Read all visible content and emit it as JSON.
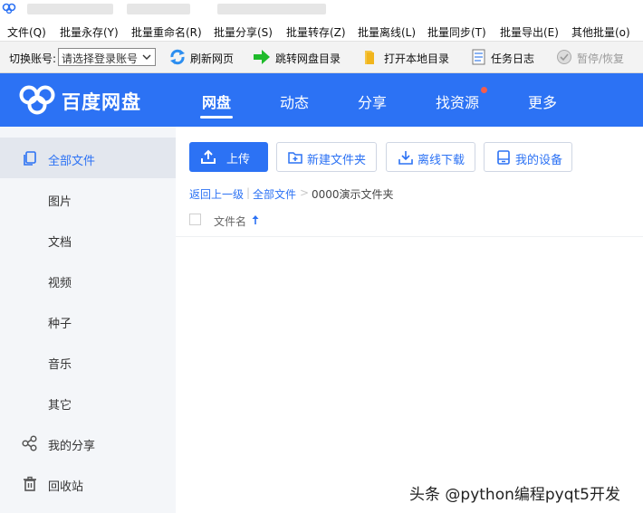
{
  "menubar": {
    "items": [
      "文件(Q)",
      "批量永存(Y)",
      "批量重命名(R)",
      "批量分享(S)",
      "批量转存(Z)",
      "批量离线(L)",
      "批量同步(T)",
      "批量导出(E)",
      "其他批量(o)"
    ]
  },
  "toolbar": {
    "account_label": "切换账号:",
    "account_select_value": "请选择登录账号",
    "refresh": "刷新网页",
    "jump": "跳转网盘目录",
    "open_local": "打开本地目录",
    "task_log": "任务日志",
    "pause_resume": "暂停/恢复"
  },
  "header": {
    "brand": "百度网盘",
    "nav": [
      "网盘",
      "动态",
      "分享",
      "找资源",
      "更多"
    ],
    "colors": {
      "brand_blue": "#2c72f4",
      "dot_red": "#f45d4d"
    }
  },
  "sidebar": {
    "items": [
      "全部文件",
      "图片",
      "文档",
      "视频",
      "种子",
      "音乐",
      "其它",
      "我的分享",
      "回收站"
    ]
  },
  "main": {
    "upload": "上传",
    "new_folder": "新建文件夹",
    "offline_download": "离线下载",
    "my_devices": "我的设备",
    "breadcrumb": {
      "back": "返回上一级",
      "sep1": "|",
      "all": "全部文件",
      "sep2": ">",
      "current": "0000演示文件夹"
    },
    "column_filename": "文件名"
  },
  "watermark": "头条 @python编程pyqt5开发"
}
